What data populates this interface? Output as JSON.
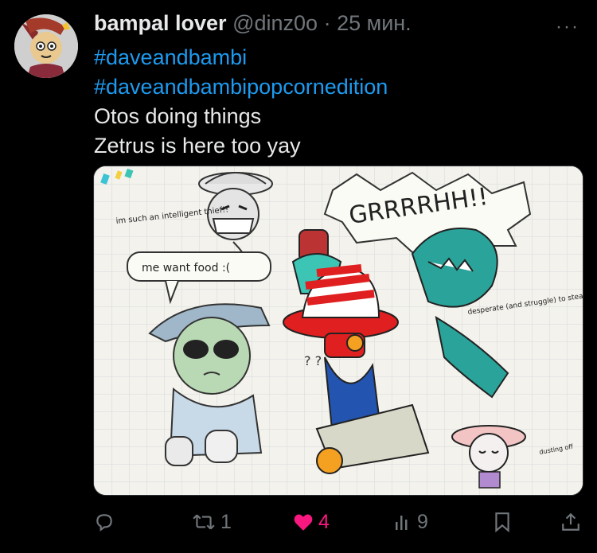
{
  "post": {
    "author": "bampal lover",
    "handle": "@dinz0o",
    "separator": "·",
    "time": "25 мин.",
    "more": "···",
    "hashtags": [
      "#daveandbambi",
      "#daveandbambipopcornedition"
    ],
    "lines": [
      "Otos doing things",
      "Zetrus is here too yay"
    ]
  },
  "image": {
    "bubble_top": "im such an intelligent thief!!",
    "bubble_left": "me want food :(",
    "shout": "GRRRRHH!!",
    "note_right": "desperate (and struggle) to steal his (Zetrus) scarf",
    "note_small": "dusting off"
  },
  "actions": {
    "reply_count": "",
    "repost_count": "1",
    "like_count": "4",
    "views_count": "9"
  },
  "colors": {
    "background": "#000000",
    "text": "#e7e9ea",
    "muted": "#71767b",
    "link": "#1d9bf0",
    "like": "#f91880"
  },
  "icons": [
    "reply-icon",
    "repost-icon",
    "heart-icon",
    "views-icon",
    "bookmark-icon",
    "share-icon",
    "more-icon"
  ]
}
